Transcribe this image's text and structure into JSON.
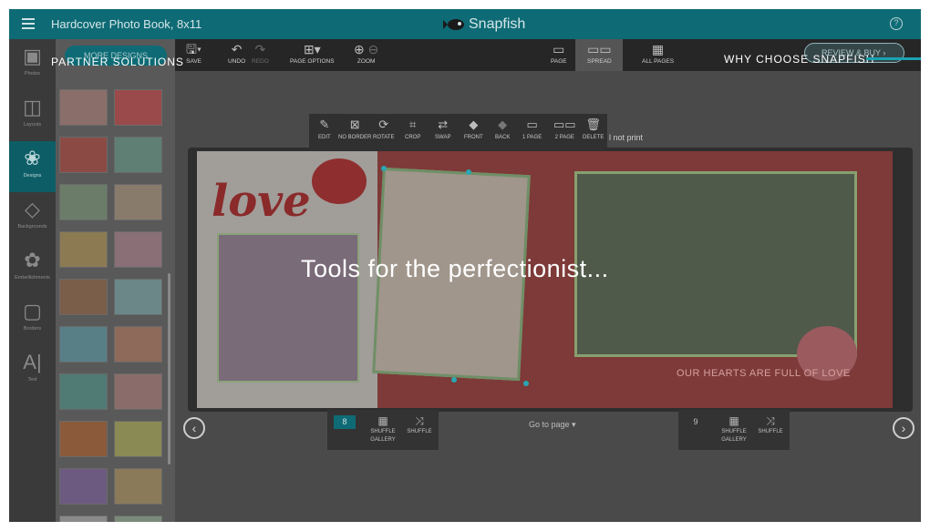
{
  "app": {
    "title": "Hardcover Photo Book, 8x11",
    "brand": "Snapfish",
    "help_glyph": "?",
    "accent": "#0e6b75"
  },
  "toolbar": {
    "save": "SAVE",
    "undo": "UNDO",
    "redo": "REDO",
    "page_options": "PAGE OPTIONS",
    "zoom": "ZOOM",
    "page": "PAGE",
    "spread": "SPREAD",
    "all_pages": "ALL PAGES",
    "review_buy": "REVIEW & BUY"
  },
  "rail": {
    "items": [
      {
        "label": "Photos",
        "icon": "photos-icon"
      },
      {
        "label": "Layouts",
        "icon": "layouts-icon"
      },
      {
        "label": "Designs",
        "icon": "designs-icon"
      },
      {
        "label": "Backgrounds",
        "icon": "backgrounds-icon"
      },
      {
        "label": "Embellishments",
        "icon": "embellishments-icon"
      },
      {
        "label": "Borders",
        "icon": "borders-icon"
      },
      {
        "label": "Text",
        "icon": "text-icon"
      }
    ]
  },
  "panel": {
    "more_designs": "MORE DESIGNS",
    "thumbs": [
      "#8a6e6a",
      "#9a4a4a",
      "#8b4b44",
      "#5f7e74",
      "#6b7d69",
      "#897b6c",
      "#8c7b52",
      "#8a6f76",
      "#7a5e4a",
      "#6b8788",
      "#587f86",
      "#8d6a5a",
      "#4f7b74",
      "#8a6d6a",
      "#8a5a3a",
      "#8a8a54",
      "#6d5a80",
      "#8a7a5a",
      "#8a8a8a",
      "#7a8a7a"
    ]
  },
  "context_toolbar": {
    "items": [
      "EDIT",
      "NO BORDER",
      "ROTATE",
      "CROP",
      "SWAP",
      "FRONT",
      "BACK",
      "1 PAGE",
      "2 PAGE",
      "DELETE"
    ]
  },
  "canvas": {
    "not_print": "l not print",
    "love_text": "love",
    "hearts_text": "OUR HEARTS ARE FULL OF LOVE",
    "goto": "Go to page ▾"
  },
  "bottom": {
    "left_page": "8",
    "right_page": "9",
    "shuffle_gallery": "SHUFFLE GALLERY",
    "shuffle": "SHUFFLE"
  },
  "overlays": {
    "partner": "PARTNER SOLUTIONS",
    "why": "WHY CHOOSE SNAPFISH",
    "tools": "Tools for the perfectionist..."
  }
}
